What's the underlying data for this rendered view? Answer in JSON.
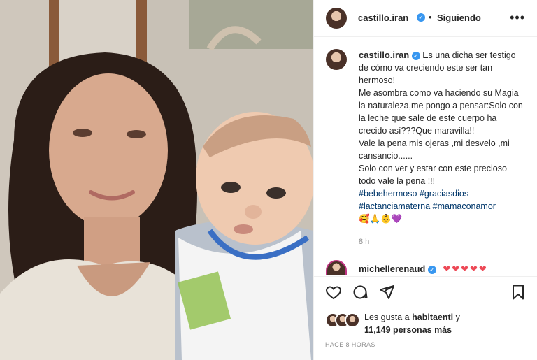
{
  "header": {
    "username": "castillo.iran",
    "separator": "•",
    "follow_status": "Siguiendo",
    "more": "•••"
  },
  "caption": {
    "username": "castillo.iran",
    "lines": [
      "Es una dicha ser testigo de cómo va creciendo este ser tan hermoso!",
      "Me asombra como va haciendo su Magia la naturaleza,me pongo a pensar:Solo con la leche que sale de este cuerpo ha crecido así???Que maravilla!!",
      "Vale la pena mis ojeras ,mi desvelo ,mi cansancio......",
      "Solo con ver y estar con este precioso todo vale la pena !!!"
    ],
    "hashtags": [
      "#bebehermoso",
      "#graciasdios",
      "#lactanciamaterna",
      "#mamaconamor"
    ],
    "emojis": "🥰🙏👶💜",
    "time": "8 h"
  },
  "comment": {
    "username": "michellerenaud",
    "text": "❤❤❤❤❤"
  },
  "likes": {
    "prefix": "Les gusta a",
    "user": "habitaenti",
    "suffix": "y",
    "others": "11,149 personas más"
  },
  "posted_ago": "HACE 8 HORAS",
  "colors": {
    "accent": "#3897f0",
    "hashtag": "#00376b",
    "muted": "#8e8e8e",
    "heart": "#ed4956"
  }
}
